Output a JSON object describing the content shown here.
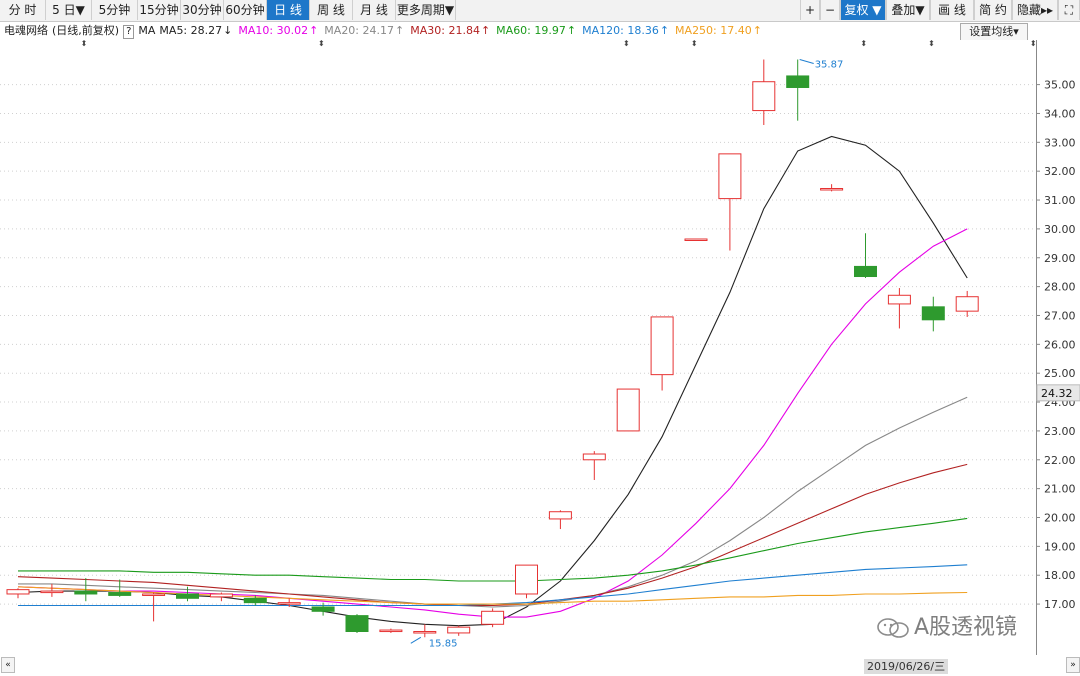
{
  "toolbar": {
    "periods": [
      "分 时",
      "5 日▼",
      "5分钟",
      "15分钟",
      "30分钟",
      "60分钟",
      "日 线",
      "周 线",
      "月 线",
      "更多周期▼"
    ],
    "active_period": "日 线",
    "right_buttons": [
      "+",
      "−",
      "复权 ▼",
      "叠加▼",
      "画 线",
      "简 约",
      "隐藏▸▸",
      "⛶"
    ],
    "active_right": "复权 ▼"
  },
  "ma_legend": {
    "stock_name": "电魂网络",
    "mode": "(日线,前复权)",
    "help": "?",
    "ma_label": "MA",
    "items": [
      {
        "text": "MA5: 28.27",
        "arrow": "↓",
        "color": "#222222"
      },
      {
        "text": "MA10: 30.02",
        "arrow": "↑",
        "color": "#e600e6"
      },
      {
        "text": "MA20: 24.17",
        "arrow": "↑",
        "color": "#888888"
      },
      {
        "text": "MA30: 21.84",
        "arrow": "↑",
        "color": "#b22222"
      },
      {
        "text": "MA60: 19.97",
        "arrow": "↑",
        "color": "#1a9a1a"
      },
      {
        "text": "MA120: 18.36",
        "arrow": "↑",
        "color": "#1f7fd0"
      },
      {
        "text": "MA250: 17.40",
        "arrow": "↑",
        "color": "#f0a020"
      }
    ],
    "settings": "设置均线▾"
  },
  "colors": {
    "up": "#e63232",
    "down": "#2e9a2e",
    "grid": "#d0d0d0",
    "axis": "#888888"
  },
  "chart_data": {
    "type": "candlestick",
    "y_ticks": [
      "17.00",
      "18.00",
      "19.00",
      "20.00",
      "21.00",
      "22.00",
      "23.00",
      "24.00",
      "25.00",
      "26.00",
      "27.00",
      "28.00",
      "29.00",
      "30.00",
      "31.00",
      "32.00",
      "33.00",
      "34.00",
      "35.00"
    ],
    "ylim": [
      16.5,
      36.4
    ],
    "current_price": "24.32",
    "high_label": "35.87",
    "low_label": "15.85",
    "date_label": "2019/06/26/三",
    "candles": [
      {
        "o": 17.35,
        "h": 17.55,
        "l": 17.2,
        "c": 17.5
      },
      {
        "o": 17.4,
        "h": 17.7,
        "l": 17.25,
        "c": 17.45
      },
      {
        "o": 17.45,
        "h": 17.9,
        "l": 17.1,
        "c": 17.35
      },
      {
        "o": 17.4,
        "h": 17.85,
        "l": 17.25,
        "c": 17.3
      },
      {
        "o": 17.3,
        "h": 17.4,
        "l": 16.4,
        "c": 17.35
      },
      {
        "o": 17.35,
        "h": 17.6,
        "l": 17.1,
        "c": 17.2
      },
      {
        "o": 17.25,
        "h": 17.4,
        "l": 17.1,
        "c": 17.35
      },
      {
        "o": 17.2,
        "h": 17.3,
        "l": 16.95,
        "c": 17.05
      },
      {
        "o": 17.0,
        "h": 17.2,
        "l": 16.9,
        "c": 17.05
      },
      {
        "o": 16.9,
        "h": 17.05,
        "l": 16.6,
        "c": 16.75
      },
      {
        "o": 16.6,
        "h": 16.65,
        "l": 16.0,
        "c": 16.05
      },
      {
        "o": 16.05,
        "h": 16.15,
        "l": 16.0,
        "c": 16.1
      },
      {
        "o": 16.0,
        "h": 16.3,
        "l": 15.85,
        "c": 16.05
      },
      {
        "o": 16.0,
        "h": 16.25,
        "l": 15.9,
        "c": 16.2
      },
      {
        "o": 16.3,
        "h": 16.85,
        "l": 16.2,
        "c": 16.75
      },
      {
        "o": 17.35,
        "h": 18.3,
        "l": 17.2,
        "c": 18.35
      },
      {
        "o": 19.95,
        "h": 20.25,
        "l": 19.6,
        "c": 20.2
      },
      {
        "o": 22.0,
        "h": 22.3,
        "l": 21.3,
        "c": 22.2
      },
      {
        "o": 23.0,
        "h": 24.45,
        "l": 23.0,
        "c": 24.45
      },
      {
        "o": 24.95,
        "h": 26.95,
        "l": 24.4,
        "c": 26.95
      },
      {
        "o": 29.65,
        "h": 29.65,
        "l": 29.65,
        "c": 29.65
      },
      {
        "o": 31.05,
        "h": 32.6,
        "l": 29.25,
        "c": 32.6
      },
      {
        "o": 34.1,
        "h": 35.87,
        "l": 33.6,
        "c": 35.1
      },
      {
        "o": 35.3,
        "h": 35.87,
        "l": 33.75,
        "c": 34.9
      },
      {
        "o": 31.4,
        "h": 31.55,
        "l": 31.3,
        "c": 31.4
      },
      {
        "o": 28.7,
        "h": 29.85,
        "l": 28.3,
        "c": 28.35
      },
      {
        "o": 27.4,
        "h": 27.95,
        "l": 26.55,
        "c": 27.7
      },
      {
        "o": 27.3,
        "h": 27.65,
        "l": 26.45,
        "c": 26.85
      },
      {
        "o": 27.15,
        "h": 27.85,
        "l": 26.95,
        "c": 27.65
      }
    ],
    "series": [
      {
        "name": "MA5",
        "color": "#222222",
        "values": [
          17.4,
          17.45,
          17.45,
          17.45,
          17.4,
          17.3,
          17.25,
          17.1,
          16.95,
          16.75,
          16.55,
          16.4,
          16.3,
          16.25,
          16.3,
          16.9,
          17.8,
          19.2,
          20.8,
          22.8,
          25.3,
          27.8,
          30.7,
          32.7,
          33.2,
          32.9,
          32.0,
          30.2,
          28.3
        ]
      },
      {
        "name": "MA10",
        "color": "#e600e6",
        "values": [
          17.6,
          17.55,
          17.5,
          17.45,
          17.45,
          17.4,
          17.35,
          17.3,
          17.2,
          17.1,
          17.0,
          16.9,
          16.8,
          16.65,
          16.55,
          16.55,
          16.75,
          17.2,
          17.8,
          18.7,
          19.8,
          21.0,
          22.5,
          24.3,
          26.0,
          27.4,
          28.5,
          29.4,
          30.0
        ]
      },
      {
        "name": "MA20",
        "color": "#888888",
        "values": [
          17.7,
          17.7,
          17.65,
          17.6,
          17.55,
          17.5,
          17.45,
          17.4,
          17.35,
          17.3,
          17.2,
          17.1,
          17.0,
          16.95,
          16.9,
          16.95,
          17.1,
          17.3,
          17.6,
          18.0,
          18.5,
          19.2,
          20.0,
          20.9,
          21.7,
          22.5,
          23.1,
          23.65,
          24.17
        ]
      },
      {
        "name": "MA30",
        "color": "#b22222",
        "values": [
          17.95,
          17.9,
          17.85,
          17.8,
          17.75,
          17.65,
          17.55,
          17.45,
          17.35,
          17.25,
          17.15,
          17.05,
          17.0,
          16.95,
          16.95,
          17.0,
          17.15,
          17.3,
          17.55,
          17.9,
          18.3,
          18.8,
          19.3,
          19.8,
          20.3,
          20.8,
          21.2,
          21.55,
          21.84
        ]
      },
      {
        "name": "MA60",
        "color": "#1a9a1a",
        "values": [
          18.15,
          18.15,
          18.15,
          18.15,
          18.1,
          18.1,
          18.05,
          18.0,
          18.0,
          17.95,
          17.9,
          17.85,
          17.85,
          17.8,
          17.8,
          17.8,
          17.85,
          17.9,
          18.0,
          18.15,
          18.35,
          18.6,
          18.85,
          19.1,
          19.3,
          19.5,
          19.65,
          19.8,
          19.97
        ]
      },
      {
        "name": "MA120",
        "color": "#1f7fd0",
        "values": [
          16.95,
          16.95,
          16.95,
          16.95,
          16.95,
          16.95,
          16.95,
          16.95,
          16.95,
          16.95,
          16.95,
          16.95,
          16.95,
          16.95,
          17.0,
          17.05,
          17.15,
          17.25,
          17.35,
          17.5,
          17.65,
          17.8,
          17.9,
          18.0,
          18.1,
          18.2,
          18.25,
          18.3,
          18.36
        ]
      },
      {
        "name": "MA250",
        "color": "#f0a020",
        "values": [
          17.6,
          17.55,
          17.5,
          17.45,
          17.4,
          17.35,
          17.3,
          17.25,
          17.2,
          17.15,
          17.1,
          17.05,
          17.0,
          17.0,
          17.0,
          17.0,
          17.05,
          17.1,
          17.1,
          17.15,
          17.2,
          17.25,
          17.25,
          17.3,
          17.3,
          17.35,
          17.35,
          17.38,
          17.4
        ]
      }
    ]
  },
  "watermark": "A股透视镜"
}
